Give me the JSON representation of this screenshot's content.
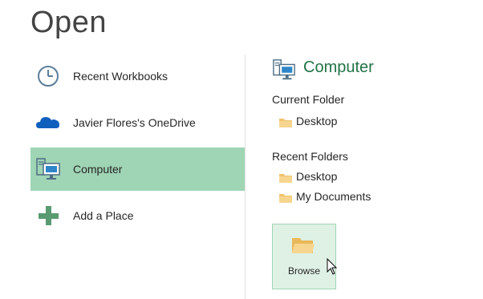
{
  "page": {
    "title": "Open"
  },
  "places": [
    {
      "label": "Recent Workbooks",
      "icon": "clock-icon"
    },
    {
      "label": "Javier Flores's OneDrive",
      "icon": "cloud-icon"
    },
    {
      "label": "Computer",
      "icon": "computer-icon"
    },
    {
      "label": "Add a Place",
      "icon": "plus-icon"
    }
  ],
  "selected_place": "Computer",
  "detail": {
    "heading": "Computer",
    "current_folder_label": "Current Folder",
    "current_folders": [
      "Desktop"
    ],
    "recent_folders_label": "Recent Folders",
    "recent_folders": [
      "Desktop",
      "My Documents"
    ],
    "browse_label": "Browse"
  },
  "colors": {
    "selected_bg": "#9fd4b4",
    "accent_green": "#217346",
    "folder": "#f0c36d",
    "onedrive_blue": "#0f5fbd"
  }
}
